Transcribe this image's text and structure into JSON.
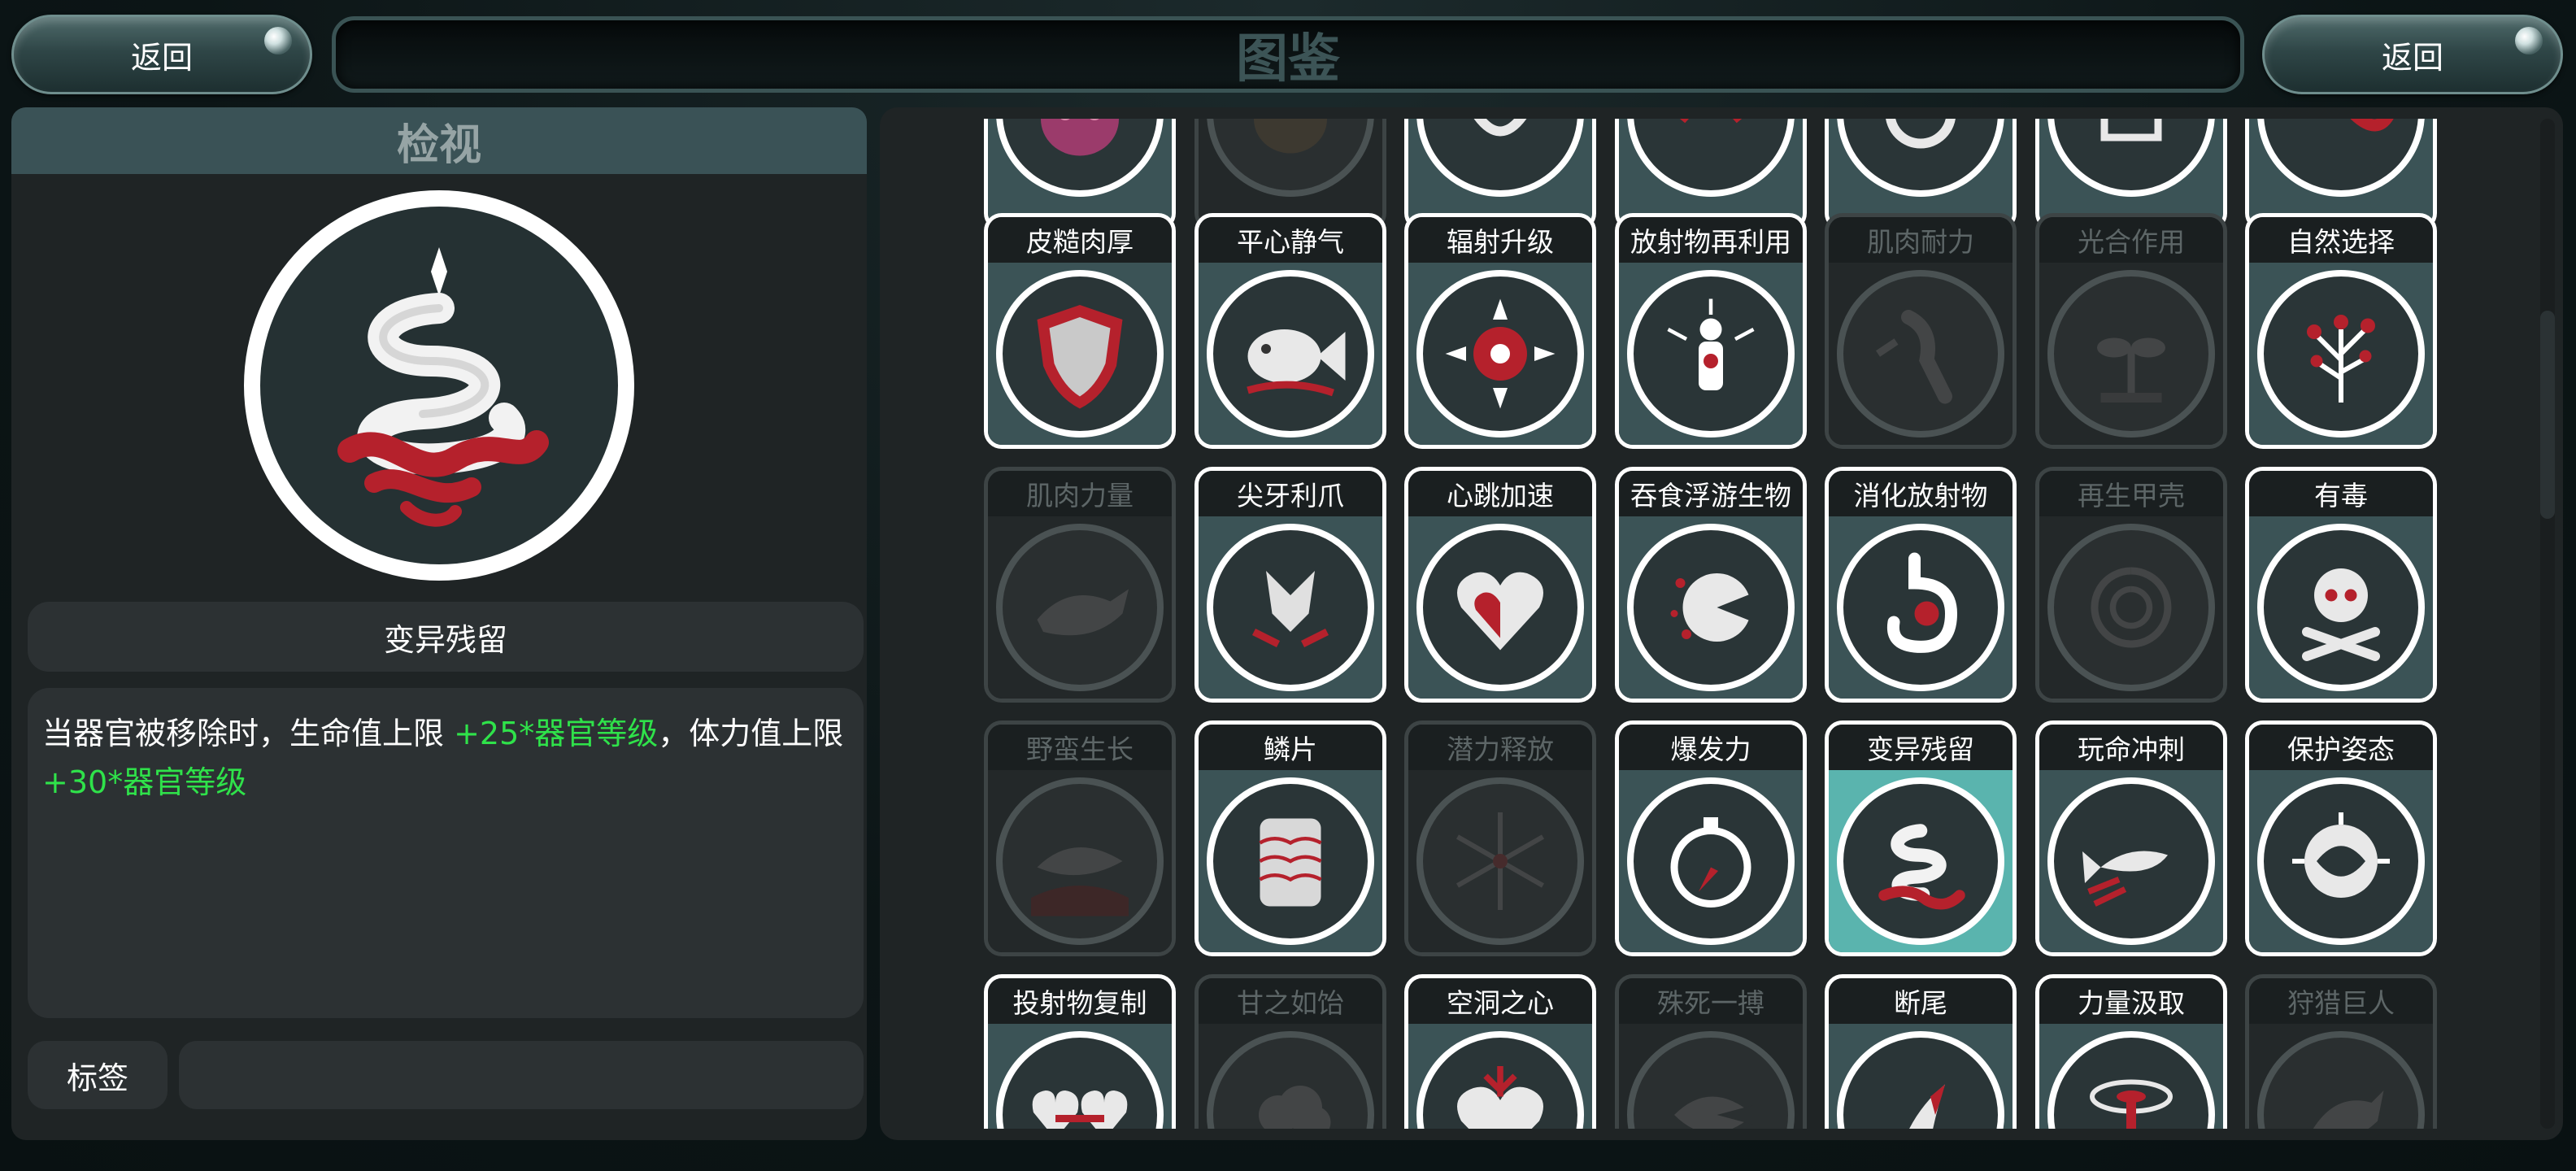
{
  "header": {
    "back_left": "返回",
    "title": "图鉴",
    "back_right": "返回"
  },
  "detail": {
    "panel_title": "检视",
    "selected_name": "变异残留",
    "description": {
      "part1": "当器官被移除时，生命值上限 ",
      "bonus1": "+25*器官等级",
      "part2": "，体力值上限 ",
      "bonus2": "+30*器官等级"
    },
    "tag_label": "标签",
    "tag_value": "",
    "icon": "coiled-serpent-icon"
  },
  "colors": {
    "accent_panel": "#3a5256",
    "card_body": "#3b5356",
    "selected_body": "#5ab4ae",
    "bonus_text": "#2fe24a"
  },
  "grid": {
    "rows": [
      [
        {
          "label": "",
          "icon": "pink-creature-icon",
          "locked": false,
          "selected": false
        },
        {
          "label": "",
          "icon": "dark-creature-icon",
          "locked": true,
          "selected": false
        },
        {
          "label": "",
          "icon": "swirl-icon",
          "locked": false,
          "selected": false
        },
        {
          "label": "",
          "icon": "red-swirl-icon",
          "locked": false,
          "selected": false
        },
        {
          "label": "",
          "icon": "vortex-icon",
          "locked": false,
          "selected": false
        },
        {
          "label": "",
          "icon": "structure-icon",
          "locked": false,
          "selected": false
        },
        {
          "label": "",
          "icon": "red-wave-icon",
          "locked": false,
          "selected": false
        }
      ],
      [
        {
          "label": "皮糙肉厚",
          "icon": "shield-icon",
          "locked": false,
          "selected": false
        },
        {
          "label": "平心静气",
          "icon": "fish-icon",
          "locked": false,
          "selected": false
        },
        {
          "label": "辐射升级",
          "icon": "radiation-compass-icon",
          "locked": false,
          "selected": false
        },
        {
          "label": "放射物再利用",
          "icon": "radiant-human-icon",
          "locked": false,
          "selected": false
        },
        {
          "label": "肌肉耐力",
          "icon": "running-leg-icon",
          "locked": true,
          "selected": false
        },
        {
          "label": "光合作用",
          "icon": "sprout-icon",
          "locked": true,
          "selected": false
        },
        {
          "label": "自然选择",
          "icon": "tree-icon",
          "locked": false,
          "selected": false
        }
      ],
      [
        {
          "label": "肌肉力量",
          "icon": "whale-icon",
          "locked": true,
          "selected": false
        },
        {
          "label": "尖牙利爪",
          "icon": "dragon-claw-icon",
          "locked": false,
          "selected": false
        },
        {
          "label": "心跳加速",
          "icon": "heart-icon",
          "locked": false,
          "selected": false
        },
        {
          "label": "吞食浮游生物",
          "icon": "plankton-eater-icon",
          "locked": false,
          "selected": false
        },
        {
          "label": "消化放射物",
          "icon": "stomach-icon",
          "locked": false,
          "selected": false
        },
        {
          "label": "再生甲壳",
          "icon": "shell-icon",
          "locked": true,
          "selected": false
        },
        {
          "label": "有毒",
          "icon": "skull-icon",
          "locked": false,
          "selected": false
        }
      ],
      [
        {
          "label": "野蛮生长",
          "icon": "shark-icon",
          "locked": true,
          "selected": false
        },
        {
          "label": "鳞片",
          "icon": "scales-icon",
          "locked": false,
          "selected": false
        },
        {
          "label": "潜力释放",
          "icon": "burst-icon",
          "locked": true,
          "selected": false
        },
        {
          "label": "爆发力",
          "icon": "stopwatch-icon",
          "locked": false,
          "selected": false
        },
        {
          "label": "变异残留",
          "icon": "coiled-serpent-icon",
          "locked": false,
          "selected": true
        },
        {
          "label": "玩命冲刺",
          "icon": "dashing-fish-icon",
          "locked": false,
          "selected": false
        },
        {
          "label": "保护姿态",
          "icon": "curled-creature-icon",
          "locked": false,
          "selected": false
        }
      ],
      [
        {
          "label": "投射物复制",
          "icon": "twin-hearts-icon",
          "locked": false,
          "selected": false
        },
        {
          "label": "甘之如饴",
          "icon": "cloud-icon",
          "locked": true,
          "selected": false
        },
        {
          "label": "空洞之心",
          "icon": "hollow-heart-icon",
          "locked": false,
          "selected": false
        },
        {
          "label": "殊死一搏",
          "icon": "piranha-icon",
          "locked": true,
          "selected": false
        },
        {
          "label": "断尾",
          "icon": "tail-icon",
          "locked": false,
          "selected": false
        },
        {
          "label": "力量汲取",
          "icon": "drain-icon",
          "locked": false,
          "selected": false
        },
        {
          "label": "狩猎巨人",
          "icon": "giant-hunt-icon",
          "locked": true,
          "selected": false
        }
      ]
    ]
  }
}
